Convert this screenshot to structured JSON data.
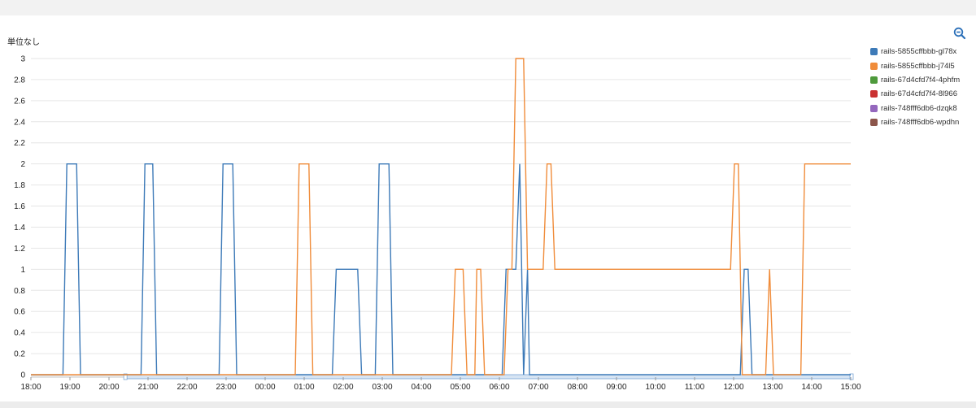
{
  "unit_label": "単位なし",
  "zoom_icon": "zoom-out-icon",
  "colors": {
    "grid": "#e6e6e6",
    "axis": "#999999"
  },
  "chart_data": {
    "type": "line",
    "ylabel": "単位なし",
    "ylim": [
      0,
      3
    ],
    "yticks": [
      0,
      0.2,
      0.4,
      0.6,
      0.8,
      1,
      1.2,
      1.4,
      1.6,
      1.8,
      2,
      2.2,
      2.4,
      2.6,
      2.8,
      3
    ],
    "xlim": [
      0,
      21
    ],
    "xtick_labels": [
      "18:00",
      "19:00",
      "20:00",
      "21:00",
      "22:00",
      "23:00",
      "00:00",
      "01:00",
      "02:00",
      "03:00",
      "04:00",
      "05:00",
      "06:00",
      "07:00",
      "08:00",
      "09:00",
      "10:00",
      "11:00",
      "12:00",
      "13:00",
      "14:00",
      "15:00"
    ],
    "x_unit": "hours",
    "grid": true,
    "legend_position": "right",
    "series": [
      {
        "name": "rails-5855cffbbb-gl78x",
        "color": "#3d7ab8",
        "x": [
          0,
          0.82,
          0.92,
          1.17,
          1.27,
          2.82,
          2.92,
          3.12,
          3.22,
          4.82,
          4.92,
          5.17,
          5.27,
          7.72,
          7.82,
          8.37,
          8.47,
          8.82,
          8.92,
          9.17,
          9.27,
          12.07,
          12.17,
          12.42,
          12.52,
          12.62,
          12.72,
          12.77,
          18.17,
          18.27,
          18.37,
          18.47,
          21
        ],
        "y": [
          0,
          0,
          2,
          2,
          0,
          0,
          2,
          2,
          0,
          0,
          2,
          2,
          0,
          0,
          1,
          1,
          0,
          0,
          2,
          2,
          0,
          0,
          1,
          1,
          2,
          0,
          1,
          0,
          0,
          1,
          1,
          0,
          0
        ]
      },
      {
        "name": "rails-5855cffbbb-j74l5",
        "color": "#f08c3a",
        "x": [
          0,
          6.77,
          6.87,
          7.12,
          7.22,
          10.77,
          10.87,
          11.07,
          11.17,
          11.37,
          11.42,
          11.52,
          11.62,
          12.12,
          12.22,
          12.32,
          12.42,
          12.62,
          12.72,
          13.12,
          13.22,
          13.32,
          13.42,
          17.92,
          18.02,
          18.12,
          18.22,
          18.82,
          18.92,
          19.02,
          19.72,
          19.82,
          21
        ],
        "y": [
          0,
          0,
          2,
          2,
          0,
          0,
          1,
          1,
          0,
          0,
          1,
          1,
          0,
          0,
          1,
          1,
          3,
          3,
          1,
          1,
          2,
          2,
          1,
          1,
          2,
          2,
          0,
          0,
          1,
          0,
          0,
          2,
          2
        ]
      },
      {
        "name": "rails-67d4cfd7f4-4phfm",
        "color": "#4e9a3c",
        "x": [],
        "y": []
      },
      {
        "name": "rails-67d4cfd7f4-8l966",
        "color": "#c93131",
        "x": [],
        "y": []
      },
      {
        "name": "rails-748fff6db6-dzqk8",
        "color": "#9467bd",
        "x": [],
        "y": []
      },
      {
        "name": "rails-748fff6db6-wpdhn",
        "color": "#8c564b",
        "x": [],
        "y": []
      }
    ]
  }
}
